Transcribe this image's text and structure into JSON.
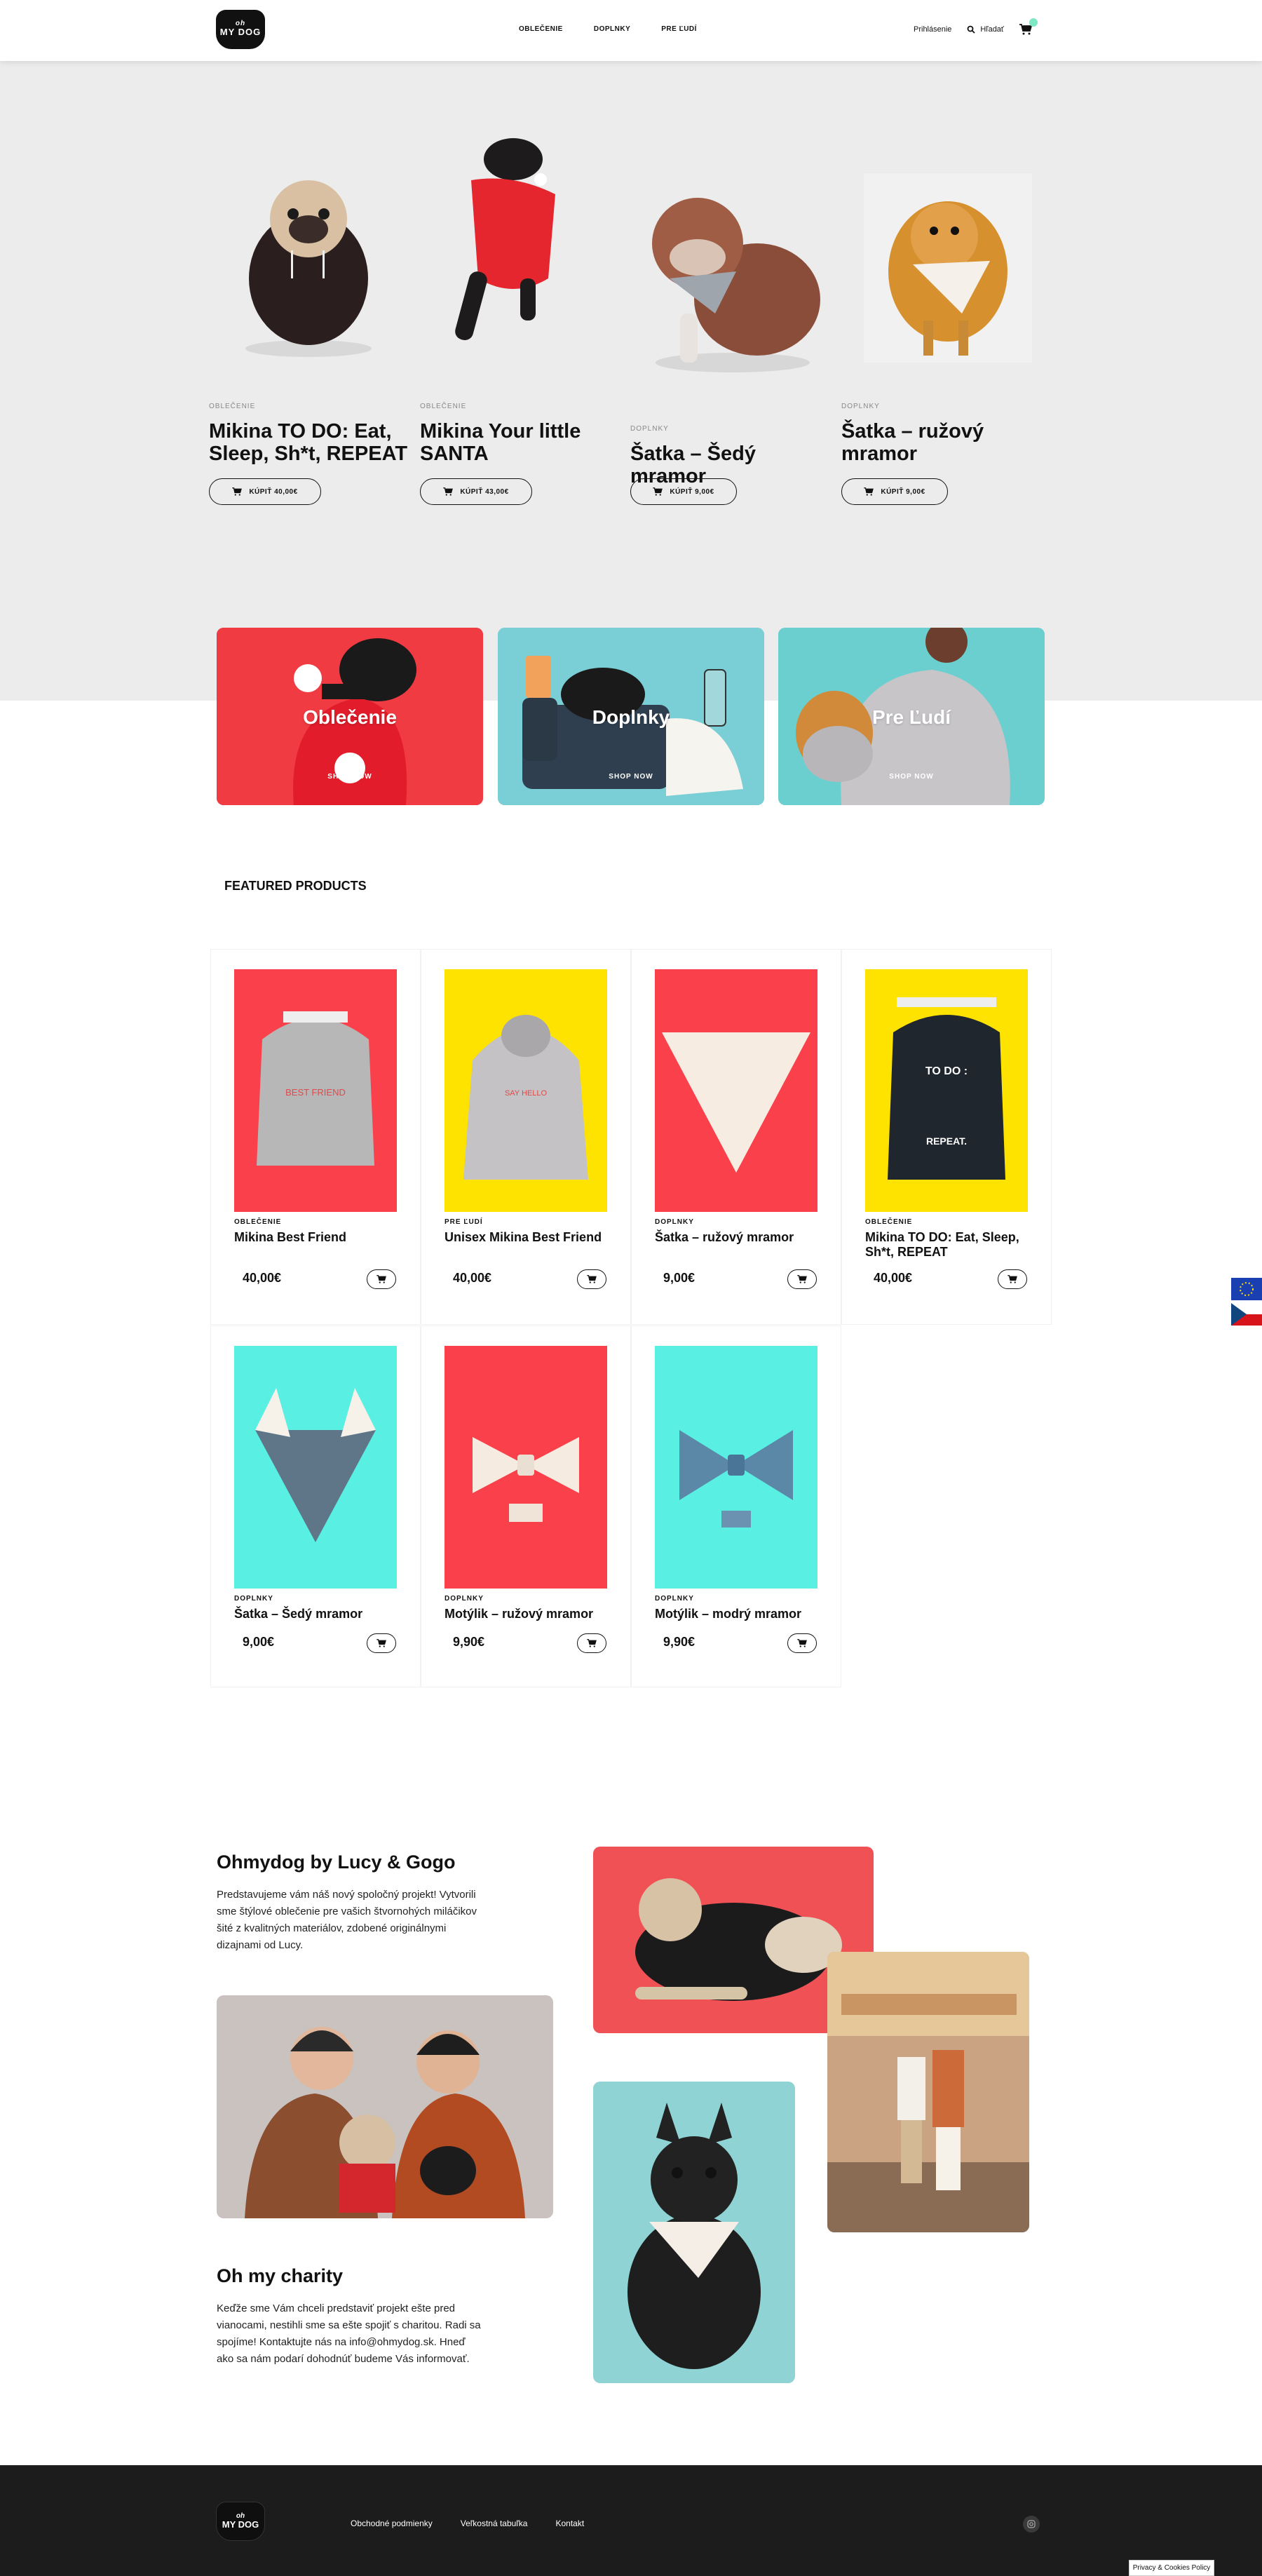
{
  "header": {
    "logo_top": "oh",
    "logo_main": "MY DOG",
    "nav": [
      "OBLEČENIE",
      "DOPLNKY",
      "PRE ĽUDÍ"
    ],
    "login": "Prihlásenie",
    "search": "Hľadať"
  },
  "hero": [
    {
      "category": "OBLEČENIE",
      "title": "Mikina TO DO: Eat, Sleep, Sh*t, REPEAT",
      "button": "KÚPIŤ 40,00€"
    },
    {
      "category": "OBLEČENIE",
      "title": "Mikina Your little SANTA",
      "button": "KÚPIŤ 43,00€"
    },
    {
      "category": "DOPLNKY",
      "title": "Šatka – Šedý mramor",
      "button": "KÚPIŤ 9,00€"
    },
    {
      "category": "DOPLNKY",
      "title": "Šatka – ružový mramor",
      "button": "KÚPIŤ 9,00€"
    }
  ],
  "tiles": [
    {
      "label": "Oblečenie",
      "shop": "SHOP NOW"
    },
    {
      "label": "Doplnky",
      "shop": "SHOP NOW"
    },
    {
      "label": "Pre Ľudí",
      "shop": "SHOP NOW"
    }
  ],
  "featured": {
    "title": "FEATURED PRODUCTS",
    "products": [
      {
        "category": "OBLEČENIE",
        "name": "Mikina Best Friend",
        "price": "40,00€",
        "bg": "#f9404b"
      },
      {
        "category": "PRE ĽUDÍ",
        "name": "Unisex Mikina Best Friend",
        "price": "40,00€",
        "bg": "#ffe300"
      },
      {
        "category": "DOPLNKY",
        "name": "Šatka – ružový mramor",
        "price": "9,00€",
        "bg": "#f9404b"
      },
      {
        "category": "OBLEČENIE",
        "name": "Mikina TO DO: Eat, Sleep, Sh*t, REPEAT",
        "price": "40,00€",
        "bg": "#ffe300"
      },
      {
        "category": "DOPLNKY",
        "name": "Šatka – Šedý mramor",
        "price": "9,00€",
        "bg": "#5aefe3"
      },
      {
        "category": "DOPLNKY",
        "name": "Motýlik – ružový mramor",
        "price": "9,90€",
        "bg": "#f9404b"
      },
      {
        "category": "DOPLNKY",
        "name": "Motýlik – modrý mramor",
        "price": "9,90€",
        "bg": "#5aefe3"
      }
    ]
  },
  "about": {
    "title1": "Ohmydog by Lucy & Gogo",
    "text1": "Predstavujeme vám náš nový spoločný projekt! Vytvorili sme štýlové oblečenie pre vašich štvornohých miláčikov šité z kvalitných materiálov, zdobené originálnymi dizajnami od Lucy.",
    "title2": "Oh my charity",
    "text2": "Keďže sme Vám chceli predstaviť projekt ešte pred vianocami, nestihli sme sa ešte spojiť s charitou. Radi sa spojíme! Kontaktujte nás na info@ohmydog.sk. Hneď ako sa nám podarí dohodnúť budeme Vás informovať."
  },
  "footer": {
    "links": [
      "Obchodné podmienky",
      "Veľkostná tabuľka",
      "Kontakt"
    ],
    "cookie": "Privacy & Cookies Policy"
  },
  "colors": {
    "red": "#f9404b",
    "yellow": "#ffe300",
    "aqua": "#5aefe3",
    "hero_bg": "#ececec",
    "footer_bg": "#1c1c1c"
  }
}
